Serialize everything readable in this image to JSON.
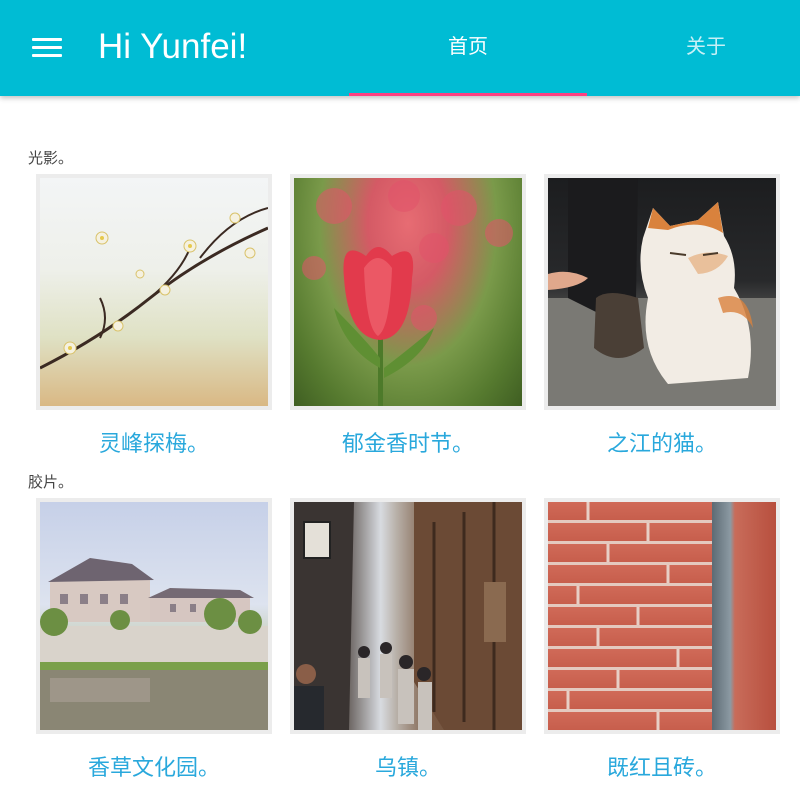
{
  "appbar": {
    "title": "Hi Yunfei!",
    "tabs": [
      {
        "label": "首页",
        "active": true
      },
      {
        "label": "关于",
        "active": false
      }
    ],
    "background_color": "#00bcd4",
    "indicator_color": "#ff4081"
  },
  "sections": [
    {
      "title": "光影。",
      "items": [
        {
          "caption": "灵峰探梅。"
        },
        {
          "caption": "郁金香时节。"
        },
        {
          "caption": "之江的猫。"
        }
      ]
    },
    {
      "title": "胶片。",
      "items": [
        {
          "caption": "香草文化园。"
        },
        {
          "caption": "乌镇。"
        },
        {
          "caption": "既红且砖。"
        }
      ]
    }
  ],
  "colors": {
    "caption": "#29a8dc"
  }
}
